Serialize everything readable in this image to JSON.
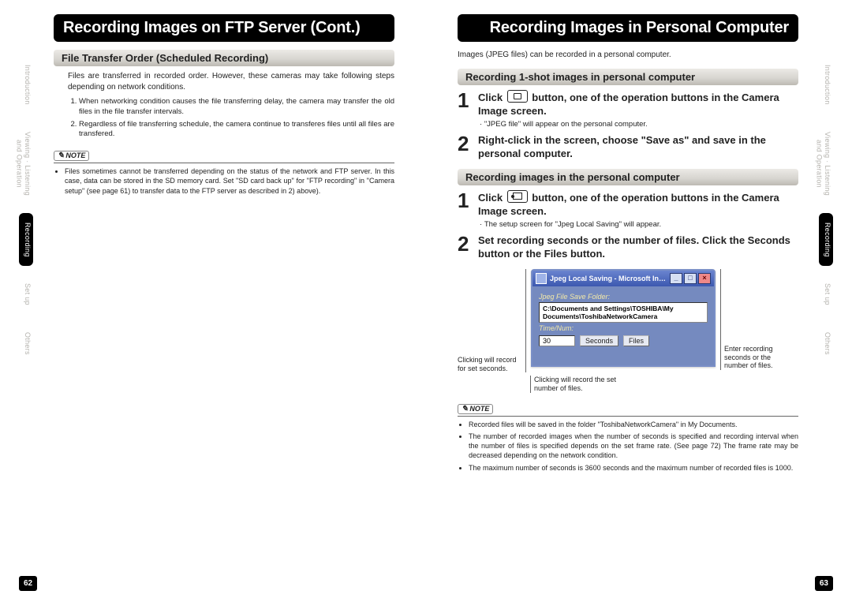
{
  "left": {
    "title": "Recording Images on FTP Server (Cont.)",
    "section": "File Transfer Order (Scheduled Recording)",
    "intro": "Files are transferred in recorded order. However, these cameras may take following steps depending on network conditions.",
    "ol": [
      "When networking condition causes the file transferring delay, the camera may transfer the old files in the file transfer intervals.",
      "Regardless of file transferring schedule, the camera continue to transferes files until all files are transfered."
    ],
    "note_label": "NOTE",
    "note": "Files sometimes cannot be transferred depending on the status of the network and FTP server.  In this case, data can be stored in the SD memory card.  Set \"SD card back up\" for \"FTP recording\" in \"Camera setup\" (see page 61) to transfer data to the FTP server as described in 2) above).",
    "page_num": "62"
  },
  "right": {
    "title": "Recording Images in Personal Computer",
    "intro": "Images (JPEG files) can be recorded in a personal computer.",
    "sectionA": "Recording 1-shot images in personal computer",
    "stepsA": {
      "s1_a": "Click ",
      "s1_b": " button, one of the operation buttons in the Camera Image screen.",
      "s1_sub": "\"JPEG file\" will appear on the personal computer.",
      "s2": "Right-click in the screen, choose \"Save as\" and save in the personal computer."
    },
    "sectionB": "Recording images in the personal computer",
    "stepsB": {
      "s1_a": "Click ",
      "s1_b": " button, one of the operation buttons in the Camera Image screen.",
      "s1_sub": "The setup screen for \"Jpeg Local Saving\" will appear.",
      "s2": "Set recording seconds or the number of files.  Click the Seconds button or the Files button."
    },
    "dialog": {
      "title": "Jpeg Local Saving - Microsoft In…",
      "folder_label": "Jpeg File Save Folder:",
      "folder_path": "C:\\Documents and Settings\\TOSHIBA\\My Documents\\ToshibaNetworkCamera",
      "timenum_label": "Time/Num:",
      "value": "30",
      "btn_seconds": "Seconds",
      "btn_files": "Files"
    },
    "callouts": {
      "left_top": "Clicking will record for set seconds.",
      "left_bottom": "Clicking will record the set number of files.",
      "right": "Enter recording seconds or the number of files."
    },
    "note_label": "NOTE",
    "notes": [
      "Recorded files will be saved in the folder \"ToshibaNetworkCamera\" in My Documents.",
      "The number of recorded images when the number of seconds is specified and recording interval when the number of files is specified depends on the set frame rate.  (See page 72)  The frame rate may be decreased depending on the network condition.",
      "The maximum number of seconds is 3600 seconds and the maximum number of recorded files is 1000."
    ],
    "page_num": "63"
  },
  "tabs": {
    "t1": "Introduction",
    "t2_a": "Viewing · Listening",
    "t2_b": "and Operation",
    "t3": "Recording",
    "t4": "Set up",
    "t5": "Others"
  }
}
